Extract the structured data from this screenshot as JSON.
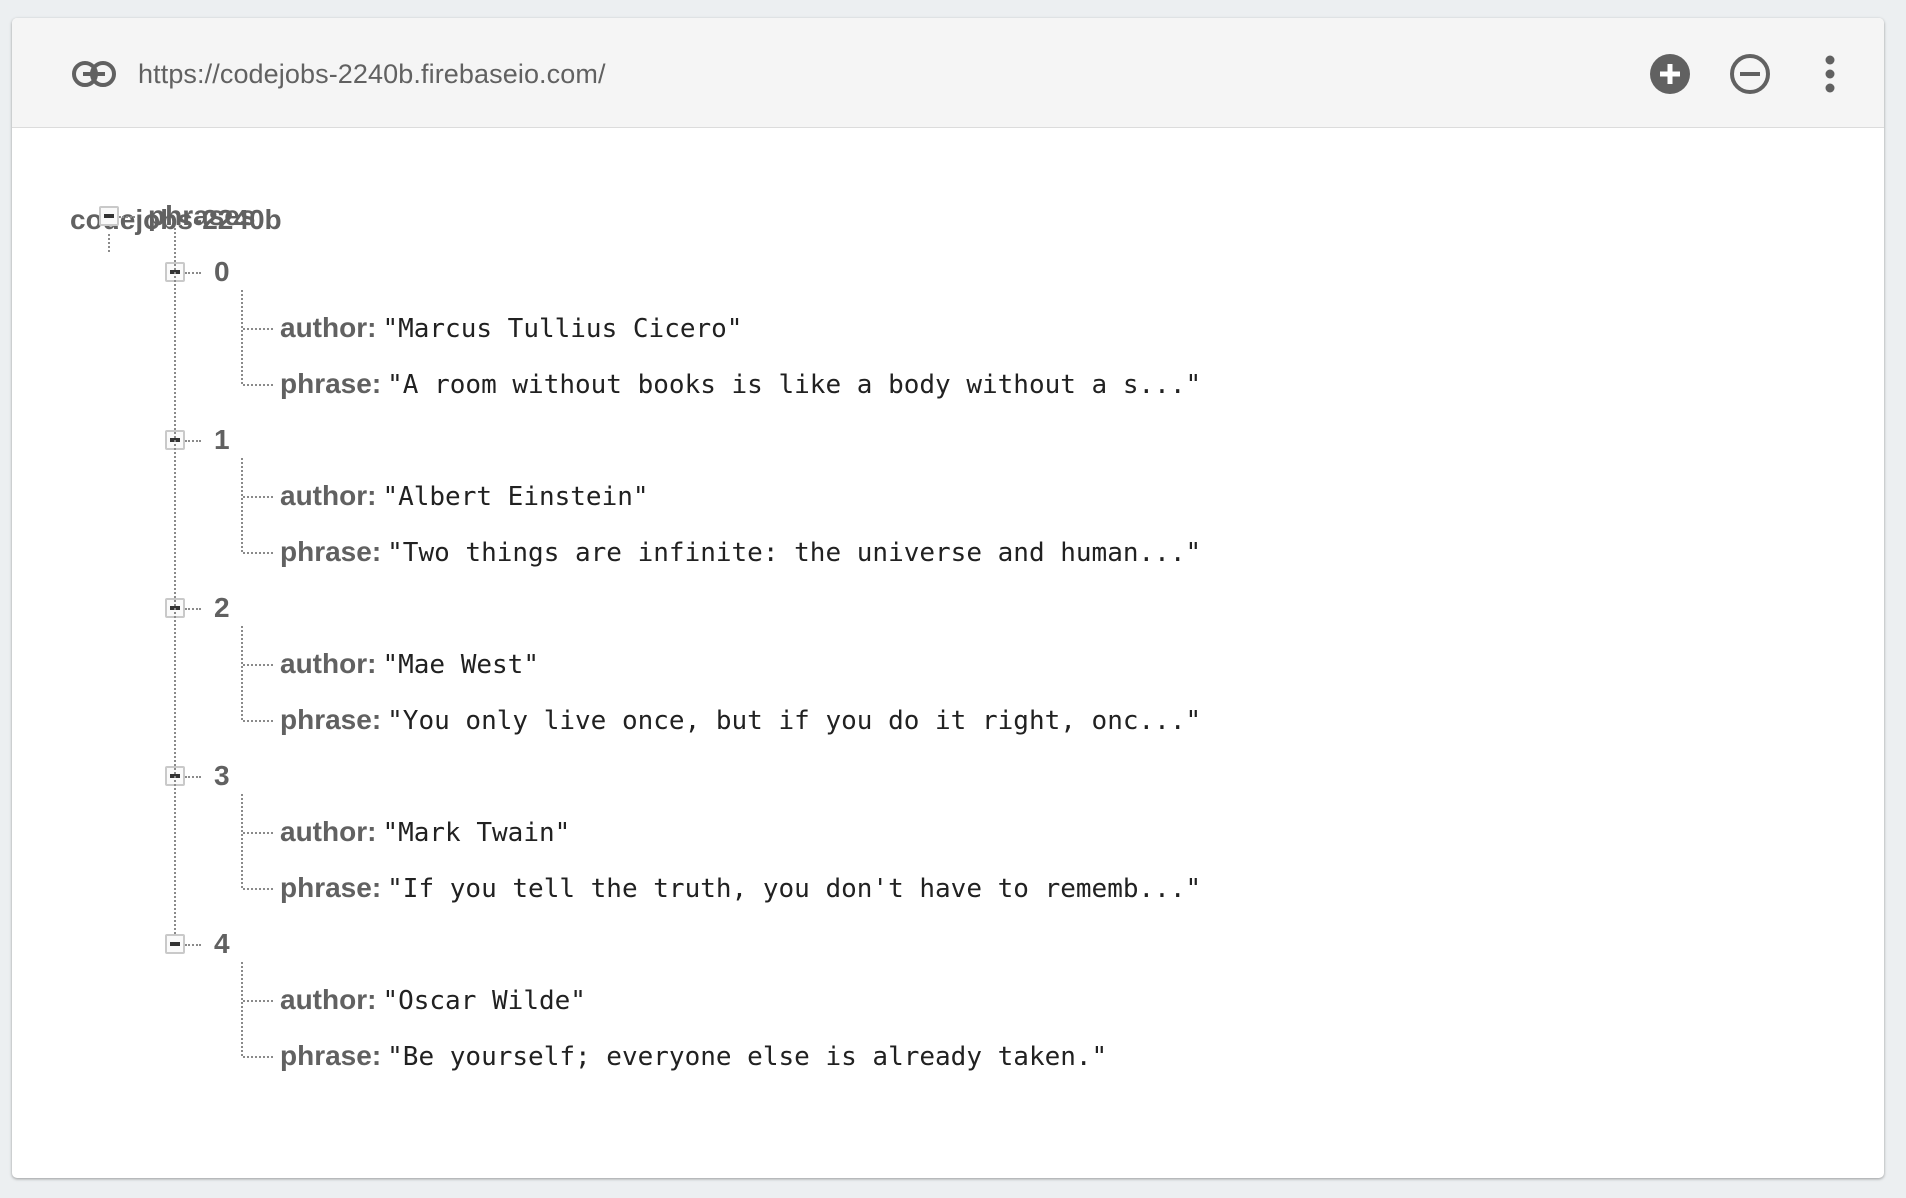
{
  "toolbar": {
    "url": "https://codejobs-2240b.firebaseio.com/",
    "icons": {
      "link": "link-icon",
      "add": "add-circle-icon",
      "remove": "remove-circle-outline-icon",
      "more": "more-vert-icon"
    }
  },
  "tree": {
    "root": "codejobs-2240b",
    "collection": {
      "key": "phrases",
      "items": [
        {
          "key": "0",
          "author_label": "author:",
          "author": "\"Marcus Tullius Cicero\"",
          "phrase_label": "phrase:",
          "phrase": "\"A room without books is like a body without a s...\""
        },
        {
          "key": "1",
          "author_label": "author:",
          "author": "\"Albert Einstein\"",
          "phrase_label": "phrase:",
          "phrase": "\"Two things are infinite: the universe and human...\""
        },
        {
          "key": "2",
          "author_label": "author:",
          "author": "\"Mae West\"",
          "phrase_label": "phrase:",
          "phrase": "\"You only live once, but if you do it right, onc...\""
        },
        {
          "key": "3",
          "author_label": "author:",
          "author": "\"Mark Twain\"",
          "phrase_label": "phrase:",
          "phrase": "\"If you tell the truth, you don't have to rememb...\""
        },
        {
          "key": "4",
          "author_label": "author:",
          "author": "\"Oscar Wilde\"",
          "phrase_label": "phrase:",
          "phrase": "\"Be yourself; everyone else is already taken.\""
        }
      ]
    }
  },
  "colors": {
    "background": "#eceff1",
    "toolbar": "#f5f5f5",
    "icon": "#616161",
    "key_text": "#616161",
    "value_text": "#212121",
    "tree_lines": "#8a8a8a"
  }
}
